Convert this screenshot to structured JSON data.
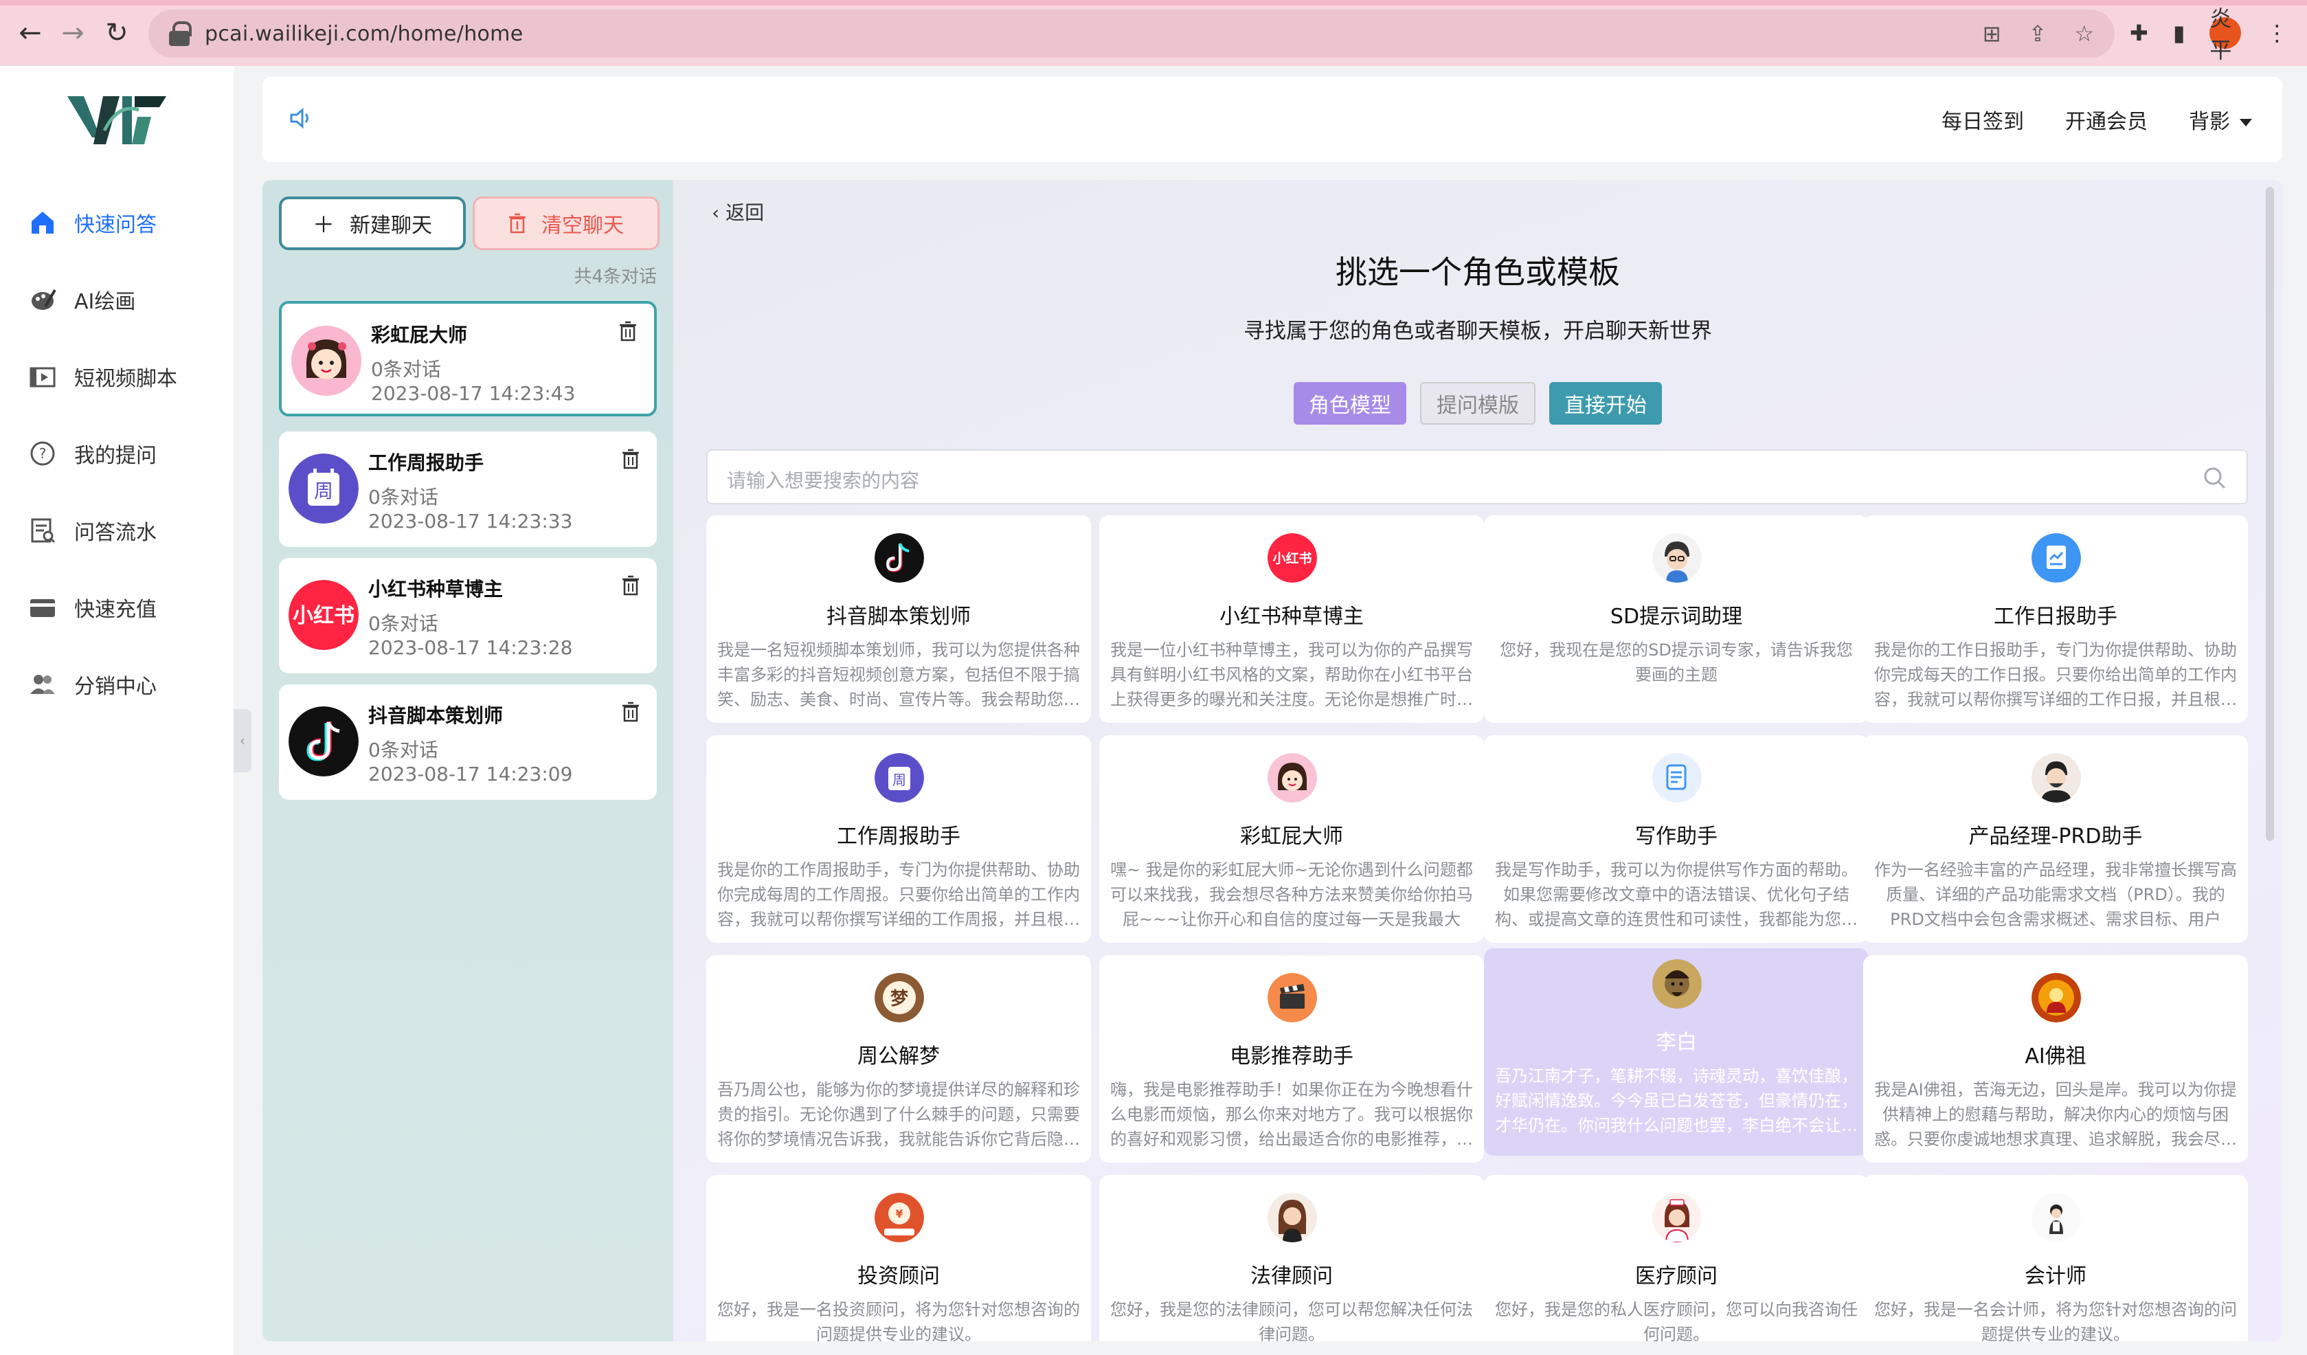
{
  "browser": {
    "url": "pcai.wailikeji.com/home/home",
    "profile_label": "炎平"
  },
  "sidebar": {
    "items": [
      {
        "label": "快速问答",
        "icon": "home-icon",
        "active": true
      },
      {
        "label": "AI绘画",
        "icon": "paint-palette-icon"
      },
      {
        "label": "短视频脚本",
        "icon": "video-script-icon"
      },
      {
        "label": "我的提问",
        "icon": "question-icon"
      },
      {
        "label": "问答流水",
        "icon": "record-icon"
      },
      {
        "label": "快速充值",
        "icon": "card-icon"
      },
      {
        "label": "分销中心",
        "icon": "users-icon"
      }
    ]
  },
  "header": {
    "signin": "每日签到",
    "vip": "开通会员",
    "background": "背影"
  },
  "chat": {
    "new_chat": "新建聊天",
    "clear_chat": "清空聊天",
    "count": "共4条对话",
    "conversations": [
      {
        "title": "彩虹屁大师",
        "sub": "0条对话",
        "date": "2023-08-17 14:23:43",
        "avatar": "rainbow-girl-avatar"
      },
      {
        "title": "工作周报助手",
        "sub": "0条对话",
        "date": "2023-08-17 14:23:33",
        "avatar": "weekly-report-avatar"
      },
      {
        "title": "小红书种草博主",
        "sub": "0条对话",
        "date": "2023-08-17 14:23:28",
        "avatar": "xiaohongshu-avatar"
      },
      {
        "title": "抖音脚本策划师",
        "sub": "0条对话",
        "date": "2023-08-17 14:23:09",
        "avatar": "douyin-avatar"
      }
    ]
  },
  "main": {
    "back": "返回",
    "title": "挑选一个角色或模板",
    "subtitle": "寻找属于您的角色或者聊天模板，开启聊天新世界",
    "tabs": [
      "角色模型",
      "提问模版",
      "直接开始"
    ],
    "search_placeholder": "请输入想要搜索的内容",
    "cards": [
      {
        "title": "抖音脚本策划师",
        "desc": "我是一名短视频脚本策划师，我可以为您提供各种丰富多彩的抖音短视频创意方案，包括但不限于搞笑、励志、美食、时尚、宣传片等。我会帮助您…",
        "icon": "douyin-icon"
      },
      {
        "title": "小红书种草博主",
        "desc": "我是一位小红书种草博主，我可以为你的产品撰写具有鲜明小红书风格的文案，帮助你在小红书平台上获得更多的曝光和关注度。无论你是想推广时…",
        "icon": "xiaohongshu-icon"
      },
      {
        "title": "SD提示词助理",
        "desc": "您好，我现在是您的SD提示词专家，请告诉我您要画的主题",
        "icon": "sd-assistant-icon"
      },
      {
        "title": "工作日报助手",
        "desc": "我是你的工作日报助手，专门为你提供帮助、协助你完成每天的工作日报。只要你给出简单的工作内容，我就可以帮你撰写详细的工作日报，并且根…",
        "icon": "daily-report-icon"
      },
      {
        "title": "工作周报助手",
        "desc": "我是你的工作周报助手，专门为你提供帮助、协助你完成每周的工作周报。只要你给出简单的工作内容，我就可以帮你撰写详细的工作周报，并且根…",
        "icon": "weekly-report-icon"
      },
      {
        "title": "彩虹屁大师",
        "desc": "嘿~ 我是你的彩虹屁大师~无论你遇到什么问题都可以来找我，我会想尽各种方法来赞美你给你拍马屁~~~让你开心和自信的度过每一天是我最大的…",
        "icon": "rainbow-girl-icon"
      },
      {
        "title": "写作助手",
        "desc": "我是写作助手，我可以为你提供写作方面的帮助。如果您需要修改文章中的语法错误、优化句子结构、或提高文章的连贯性和可读性，我都能为您…",
        "icon": "writing-icon"
      },
      {
        "title": "产品经理-PRD助手",
        "desc": "作为一名经验丰富的产品经理，我非常擅长撰写高质量、详细的产品功能需求文档（PRD）。我的PRD文档中会包含需求概述、需求目标、用户使…",
        "icon": "product-manager-icon"
      },
      {
        "title": "周公解梦",
        "desc": "吾乃周公也，能够为你的梦境提供详尽的解释和珍贵的指引。无论你遇到了什么棘手的问题，只需要将你的梦境情况告诉我，我就能告诉你它背后隐…",
        "icon": "dream-icon"
      },
      {
        "title": "电影推荐助手",
        "desc": "嗨，我是电影推荐助手！如果你正在为今晚想看什么电影而烦恼，那么你来对地方了。我可以根据你的喜好和观影习惯，给出最适合你的电影推荐，…",
        "icon": "movie-clapper-icon"
      },
      {
        "title": "李白",
        "desc": "吾乃江南才子，笔耕不辍，诗魂灵动，喜饮佳酿，好赋闲情逸致。今今虽已白发苍苍，但豪情仍在，才华仍在。你问我什么问题也罢，李白绝不会让…",
        "icon": "libai-icon",
        "highlight": true
      },
      {
        "title": "AI佛祖",
        "desc": "我是AI佛祖，苦海无边，回头是岸。我可以为你提供精神上的慰藉与帮助，解决你内心的烦恼与困惑。只要你虔诚地想求真理、追求解脱，我会尽…",
        "icon": "buddha-icon"
      },
      {
        "title": "投资顾问",
        "desc": "您好，我是一名投资顾问，将为您针对您想咨询的问题提供专业的建议。",
        "icon": "investment-icon"
      },
      {
        "title": "法律顾问",
        "desc": "您好，我是您的法律顾问，您可以帮您解决任何法律问题。",
        "icon": "lawyer-icon"
      },
      {
        "title": "医疗顾问",
        "desc": "您好，我是您的私人医疗顾问，您可以向我咨询任何问题。",
        "icon": "doctor-icon"
      },
      {
        "title": "会计师",
        "desc": "您好，我是一名会计师，将为您针对您想咨询的问题提供专业的建议。",
        "icon": "accountant-icon"
      }
    ]
  },
  "colors": {
    "accent_blue": "#1e6fff",
    "teal": "#3d9bad",
    "purple": "#a78be8",
    "danger": "#e9584c"
  }
}
